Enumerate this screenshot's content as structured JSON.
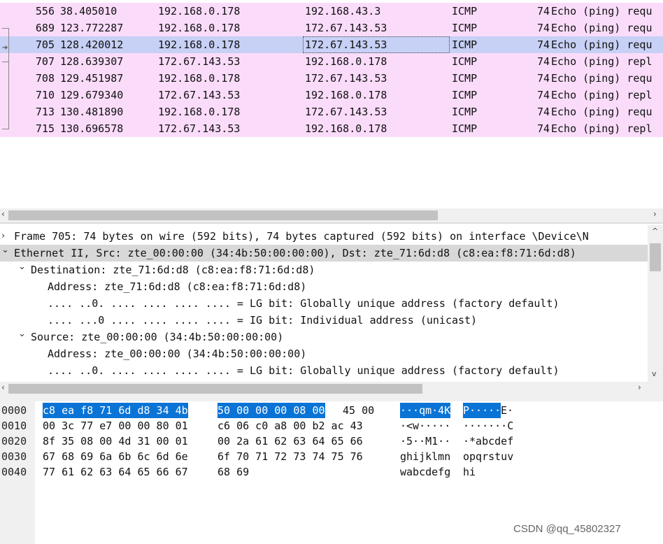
{
  "packet_list": {
    "rows": [
      {
        "no": "556",
        "time": "38.405010",
        "src": "192.168.0.178",
        "dst": "192.168.43.3",
        "proto": "ICMP",
        "len": "74",
        "info": "Echo (ping) requ",
        "selected": false
      },
      {
        "no": "689",
        "time": "123.772287",
        "src": "192.168.0.178",
        "dst": "172.67.143.53",
        "proto": "ICMP",
        "len": "74",
        "info": "Echo (ping) requ",
        "selected": false
      },
      {
        "no": "705",
        "time": "128.420012",
        "src": "192.168.0.178",
        "dst": "172.67.143.53",
        "proto": "ICMP",
        "len": "74",
        "info": "Echo (ping) requ",
        "selected": true
      },
      {
        "no": "707",
        "time": "128.639307",
        "src": "172.67.143.53",
        "dst": "192.168.0.178",
        "proto": "ICMP",
        "len": "74",
        "info": "Echo (ping) repl",
        "selected": false
      },
      {
        "no": "708",
        "time": "129.451987",
        "src": "192.168.0.178",
        "dst": "172.67.143.53",
        "proto": "ICMP",
        "len": "74",
        "info": "Echo (ping) requ",
        "selected": false
      },
      {
        "no": "710",
        "time": "129.679340",
        "src": "172.67.143.53",
        "dst": "192.168.0.178",
        "proto": "ICMP",
        "len": "74",
        "info": "Echo (ping) repl",
        "selected": false
      },
      {
        "no": "713",
        "time": "130.481890",
        "src": "192.168.0.178",
        "dst": "172.67.143.53",
        "proto": "ICMP",
        "len": "74",
        "info": "Echo (ping) requ",
        "selected": false
      },
      {
        "no": "715",
        "time": "130.696578",
        "src": "172.67.143.53",
        "dst": "192.168.0.178",
        "proto": "ICMP",
        "len": "74",
        "info": "Echo (ping) repl",
        "selected": false
      }
    ]
  },
  "details": {
    "lines": [
      {
        "exp": ">",
        "text": "Frame 705: 74 bytes on wire (592 bits), 74 bytes captured (592 bits) on interface \\Device\\N",
        "highlight": false
      },
      {
        "exp": "v",
        "text": "Ethernet II, Src: zte_00:00:00 (34:4b:50:00:00:00), Dst: zte_71:6d:d8 (c8:ea:f8:71:6d:d8)",
        "highlight": true
      },
      {
        "exp": "v",
        "text": "Destination: zte_71:6d:d8 (c8:ea:f8:71:6d:d8)",
        "highlight": false
      },
      {
        "exp": "",
        "text": "Address: zte_71:6d:d8 (c8:ea:f8:71:6d:d8)",
        "highlight": false
      },
      {
        "exp": "",
        "text": ".... ..0. .... .... .... .... = LG bit: Globally unique address (factory default)",
        "highlight": false
      },
      {
        "exp": "",
        "text": ".... ...0 .... .... .... .... = IG bit: Individual address (unicast)",
        "highlight": false
      },
      {
        "exp": "v",
        "text": "Source: zte_00:00:00 (34:4b:50:00:00:00)",
        "highlight": false
      },
      {
        "exp": "",
        "text": "Address: zte_00:00:00 (34:4b:50:00:00:00)",
        "highlight": false
      },
      {
        "exp": "",
        "text": ".... ..0. .... .... .... .... = LG bit: Globally unique address (factory default)",
        "highlight": false
      }
    ]
  },
  "bytes": {
    "rows": [
      {
        "offset": "0000",
        "hex1": "c8 ea f8 71 6d d8 34 4b",
        "hex2": "50 00 00 00 08 00",
        "hex2_rest": " 45 00",
        "ascii1": "···qm·4K",
        "ascii2": "P·····",
        "ascii2_rest": "E·"
      },
      {
        "offset": "0010",
        "hex1": "00 3c 77 e7 00 00 80 01",
        "hex2": "c6 06 c0 a8 00 b2 ac 43",
        "hex2_rest": "",
        "ascii1": "·<w·····",
        "ascii2": "·······C",
        "ascii2_rest": ""
      },
      {
        "offset": "0020",
        "hex1": "8f 35 08 00 4d 31 00 01",
        "hex2": "00 2a 61 62 63 64 65 66",
        "hex2_rest": "",
        "ascii1": "·5··M1··",
        "ascii2": "·*abcdef",
        "ascii2_rest": ""
      },
      {
        "offset": "0030",
        "hex1": "67 68 69 6a 6b 6c 6d 6e",
        "hex2": "6f 70 71 72 73 74 75 76",
        "hex2_rest": "",
        "ascii1": "ghijklmn",
        "ascii2": "opqrstuv",
        "ascii2_rest": ""
      },
      {
        "offset": "0040",
        "hex1": "77 61 62 63 64 65 66 67",
        "hex2": "68 69",
        "hex2_rest": "",
        "ascii1": "wabcdefg",
        "ascii2": "hi",
        "ascii2_rest": ""
      }
    ]
  },
  "watermark": "CSDN @qq_45802327",
  "icons": {
    "left_arrow": "‹",
    "right_arrow": "›",
    "up_arrow": "^",
    "down_arrow": "v"
  }
}
